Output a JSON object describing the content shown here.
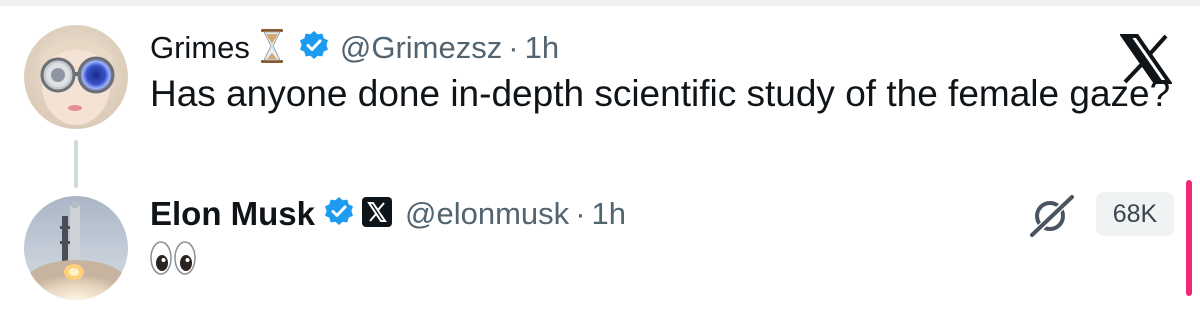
{
  "tweet": {
    "author_name": "Grimes",
    "author_emoji": "hourglass-icon",
    "handle": "@Grimezsz",
    "separator": "·",
    "time": "1h",
    "text": "Has anyone done in-depth scientific study of the female gaze?"
  },
  "reply": {
    "author_name": "Elon Musk",
    "handle": "@elonmusk",
    "separator": "·",
    "time": "1h",
    "text_emoji": "eyes-emoji",
    "views": "68K"
  },
  "colors": {
    "verified_blue": "#1d9bf0",
    "muted_text": "#536471",
    "accent_pink": "#f0287a"
  }
}
